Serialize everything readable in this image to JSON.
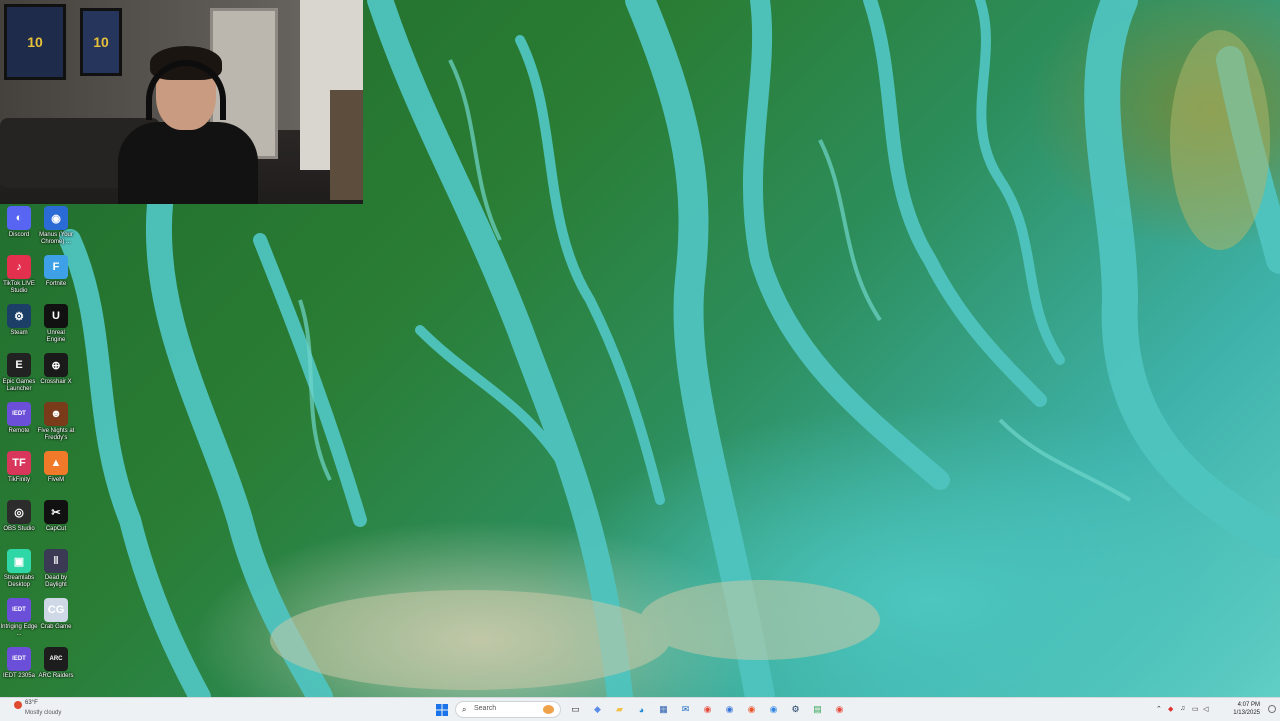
{
  "desktop": {
    "icons": [
      {
        "label": "Discord",
        "icon": "discord-icon",
        "color": "#5865f2",
        "glyph": "◐"
      },
      {
        "label": "Manus (Your Chrome) ...",
        "icon": "chrome-icon",
        "color": "#2a6bd6",
        "glyph": "◉"
      },
      {
        "label": "TikTok LIVE Studio",
        "icon": "tiktok-icon",
        "color": "#e3304e",
        "glyph": "♪"
      },
      {
        "label": "Fortnite",
        "icon": "fortnite-icon",
        "color": "#3ea0e6",
        "glyph": "F"
      },
      {
        "label": "Steam",
        "icon": "steam-icon",
        "color": "#1b3f66",
        "glyph": "⚙"
      },
      {
        "label": "Unreal Engine",
        "icon": "unreal-icon",
        "color": "#111111",
        "glyph": "U"
      },
      {
        "label": "Epic Games Launcher",
        "icon": "epic-games-icon",
        "color": "#222222",
        "glyph": "E"
      },
      {
        "label": "Crosshair X",
        "icon": "crosshair-icon",
        "color": "#1a1a1a",
        "glyph": "⊕"
      },
      {
        "label": "Remote",
        "icon": "iedt-icon",
        "color": "#6b4fd8",
        "glyph": "IEDT"
      },
      {
        "label": "Five Nights at Freddy's",
        "icon": "fnaf-icon",
        "color": "#7a3b1a",
        "glyph": "☻"
      },
      {
        "label": "TikFinity",
        "icon": "tikfinity-icon",
        "color": "#d8365a",
        "glyph": "TF"
      },
      {
        "label": "FiveM",
        "icon": "fivem-icon",
        "color": "#f07a2a",
        "glyph": "▲"
      },
      {
        "label": "OBS Studio",
        "icon": "obs-icon",
        "color": "#2c2c2c",
        "glyph": "◎"
      },
      {
        "label": "CapCut",
        "icon": "capcut-icon",
        "color": "#111111",
        "glyph": "✂"
      },
      {
        "label": "Streamlabs Desktop",
        "icon": "streamlabs-icon",
        "color": "#2fd6a6",
        "glyph": "▣"
      },
      {
        "label": "Dead by Daylight",
        "icon": "dead-by-daylight-icon",
        "color": "#3a3a55",
        "glyph": "‖"
      },
      {
        "label": "Intriging Edge ...",
        "icon": "iedt-icon",
        "color": "#6b4fd8",
        "glyph": "IEDT"
      },
      {
        "label": "Crab Game",
        "icon": "crab-game-icon",
        "color": "#cfd8e6",
        "glyph": "CG"
      },
      {
        "label": "IEDT 2305a",
        "icon": "iedt-icon",
        "color": "#6b4fd8",
        "glyph": "IEDT"
      },
      {
        "label": "ARC Raiders",
        "icon": "arc-raiders-icon",
        "color": "#1d1d1d",
        "glyph": "ARC"
      }
    ]
  },
  "webcam": {
    "jersey1": "10",
    "jersey2": "10"
  },
  "taskbar": {
    "weather": {
      "temp": "63°F",
      "condition": "Mostly cloudy",
      "icon": "weather-icon"
    },
    "start_icon": "windows-start-icon",
    "search_placeholder": "Search",
    "apps": [
      {
        "name": "task-view-icon",
        "glyph": "▭",
        "color": "#333333"
      },
      {
        "name": "copilot-icon",
        "glyph": "◆",
        "color": "#5a8de8"
      },
      {
        "name": "file-explorer-icon",
        "glyph": "▰",
        "color": "#f2c14a"
      },
      {
        "name": "edge-icon",
        "glyph": "◕",
        "color": "#1f8ad6"
      },
      {
        "name": "microsoft-store-icon",
        "glyph": "▦",
        "color": "#2a5fae"
      },
      {
        "name": "outlook-icon",
        "glyph": "✉",
        "color": "#1565c0"
      },
      {
        "name": "chrome-icon",
        "glyph": "◉",
        "color": "#e54b3c"
      },
      {
        "name": "chrome-profile-icon",
        "glyph": "◉",
        "color": "#3a75d8"
      },
      {
        "name": "brave-icon",
        "glyph": "◉",
        "color": "#e8542a"
      },
      {
        "name": "chrome-icon",
        "glyph": "◉",
        "color": "#2f86e4"
      },
      {
        "name": "steam-icon",
        "glyph": "⚙",
        "color": "#1b3f66"
      },
      {
        "name": "notepad-icon",
        "glyph": "▤",
        "color": "#3aa55a"
      },
      {
        "name": "chrome-icon",
        "glyph": "◉",
        "color": "#e54b3c"
      }
    ],
    "tray": {
      "clock_time": "4:07 PM",
      "clock_date": "1/13/2025"
    }
  }
}
